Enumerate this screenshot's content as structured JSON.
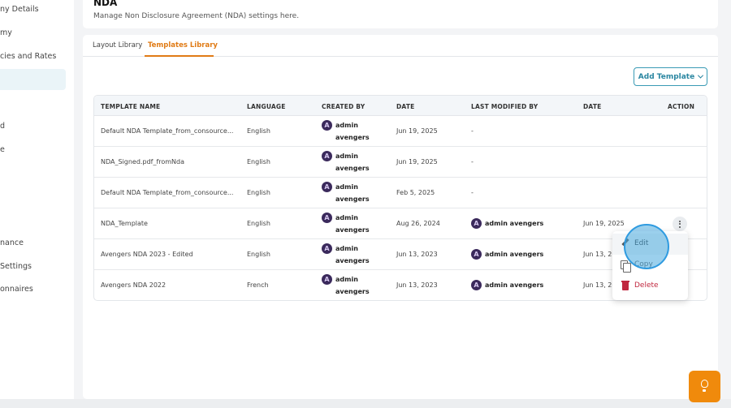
{
  "sidebar": {
    "items": [
      {
        "label": "ny Details"
      },
      {
        "label": "my"
      },
      {
        "label": "cies and Rates"
      },
      {
        "label": ""
      },
      {
        "label": "d"
      },
      {
        "label": "e"
      },
      {
        "label": "nance"
      },
      {
        "label": " Settings"
      },
      {
        "label": "onnaires"
      }
    ]
  },
  "header": {
    "title": "NDA",
    "subtitle": "Manage Non Disclosure Agreement (NDA) settings here."
  },
  "tabs": [
    {
      "label": "Layout Library",
      "active": false
    },
    {
      "label": "Templates Library",
      "active": true
    }
  ],
  "add_template_label": "Add Template",
  "table": {
    "columns": [
      "TEMPLATE NAME",
      "LANGUAGE",
      "CREATED BY",
      "DATE",
      "LAST MODIFIED BY",
      "DATE",
      "ACTION"
    ],
    "rows": [
      {
        "name": "Default NDA Template_from_consource...",
        "language": "English",
        "created_first": "admin",
        "created_last": "avengers",
        "date": "Jun 19, 2025",
        "modified_by": "-",
        "modified_date": ""
      },
      {
        "name": "NDA_Signed.pdf_fromNda",
        "language": "English",
        "created_first": "admin",
        "created_last": "avengers",
        "date": "Jun 19, 2025",
        "modified_by": "-",
        "modified_date": ""
      },
      {
        "name": "Default NDA Template_from_consource...",
        "language": "English",
        "created_first": "admin",
        "created_last": "avengers",
        "date": "Feb 5, 2025",
        "modified_by": "-",
        "modified_date": ""
      },
      {
        "name": "NDA_Template",
        "language": "English",
        "created_first": "admin",
        "created_last": "avengers",
        "date": "Aug 26, 2024",
        "modified_by": "admin avengers",
        "modified_date": "Jun 19, 2025"
      },
      {
        "name": "Avengers NDA 2023 - Edited",
        "language": "English",
        "created_first": "admin",
        "created_last": "avengers",
        "date": "Jun 13, 2023",
        "modified_by": "admin avengers",
        "modified_date": "Jun 13, 20"
      },
      {
        "name": "Avengers NDA 2022",
        "language": "French",
        "created_first": "admin",
        "created_last": "avengers",
        "date": "Jun 13, 2023",
        "modified_by": "admin avengers",
        "modified_date": "Jun 13, 20"
      }
    ]
  },
  "menu": {
    "edit": "Edit",
    "copy": "Copy",
    "delete": "Delete"
  },
  "colors": {
    "accent_orange": "#e07b16",
    "accent_teal": "#2a86a1",
    "danger": "#c0283f",
    "help_button": "#f08a0c"
  }
}
